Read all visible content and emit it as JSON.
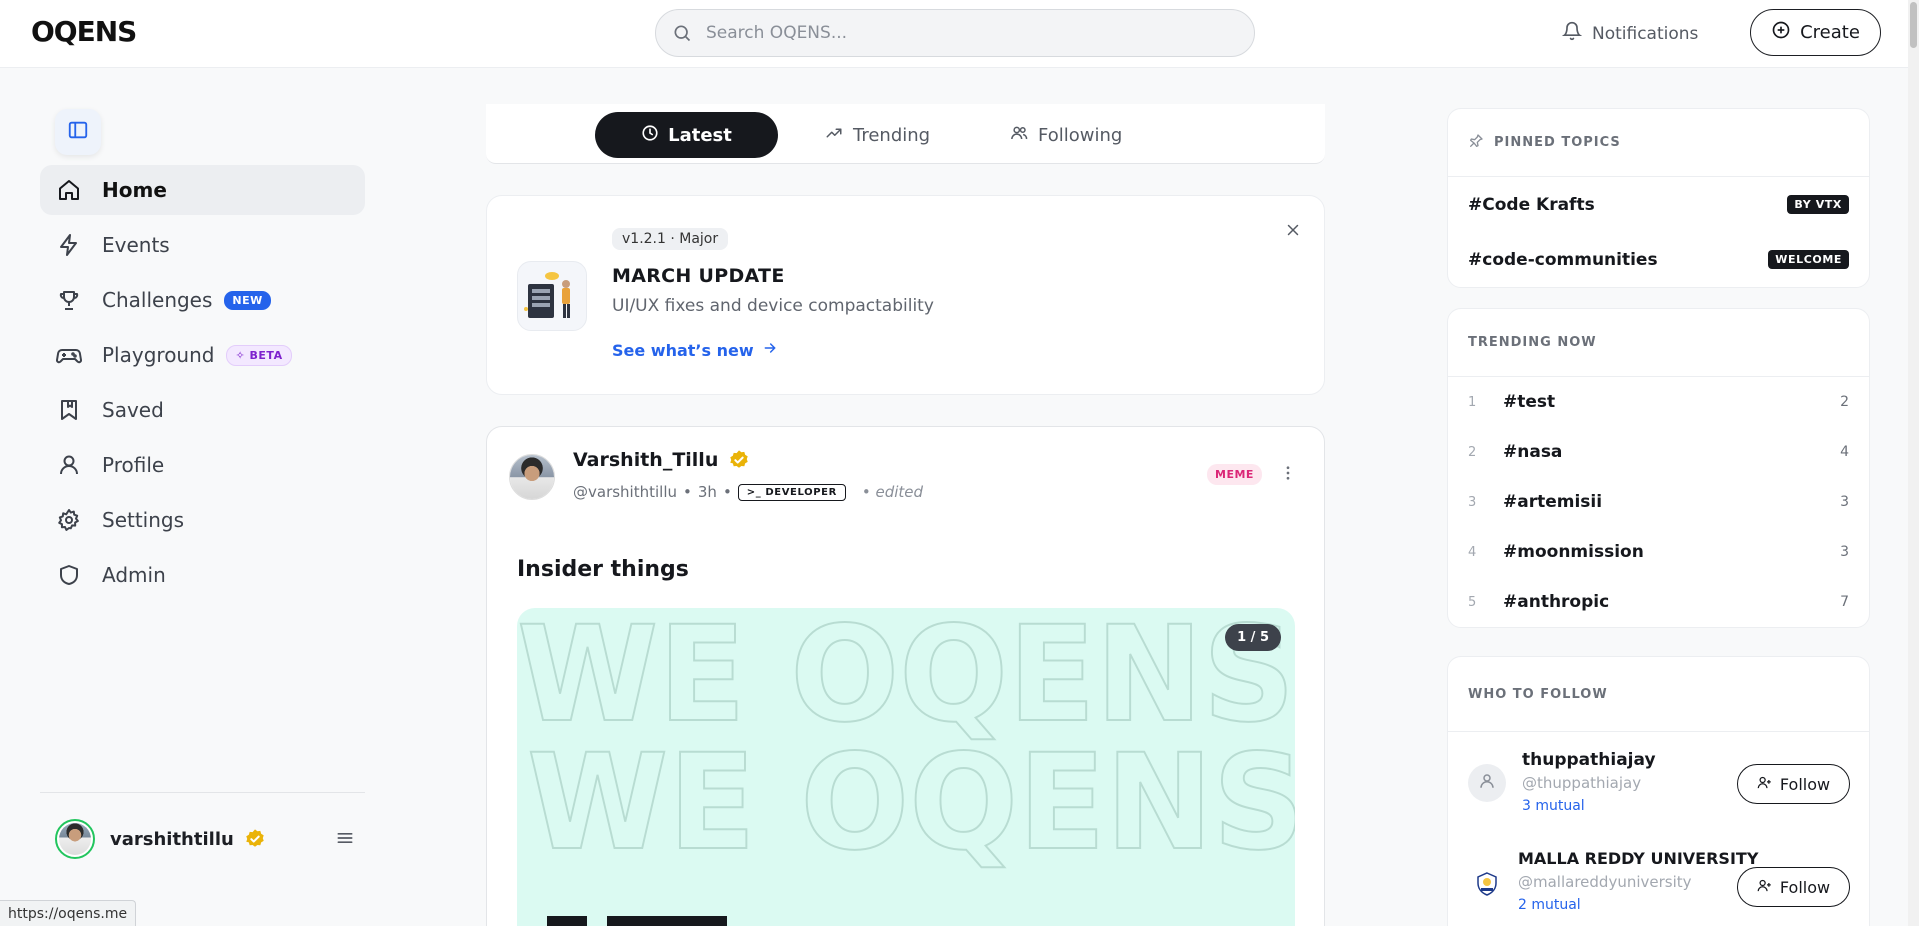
{
  "app": {
    "logo": "OQENS"
  },
  "search": {
    "placeholder": "Search OQENS..."
  },
  "header": {
    "notifications_label": "Notifications",
    "create_label": "Create"
  },
  "sidebar": {
    "items": [
      {
        "label": "Home",
        "icon": "home-icon",
        "active": true
      },
      {
        "label": "Events",
        "icon": "lightning-icon"
      },
      {
        "label": "Challenges",
        "icon": "trophy-icon",
        "badge": "NEW"
      },
      {
        "label": "Playground",
        "icon": "gamepad-icon",
        "badge": "BETA"
      },
      {
        "label": "Saved",
        "icon": "bookmark-icon"
      },
      {
        "label": "Profile",
        "icon": "user-icon"
      },
      {
        "label": "Settings",
        "icon": "gear-icon"
      },
      {
        "label": "Admin",
        "icon": "shield-icon"
      }
    ],
    "user": {
      "username": "varshithtillu"
    }
  },
  "feed_tabs": [
    {
      "label": "Latest",
      "icon": "clock-icon",
      "active": true
    },
    {
      "label": "Trending",
      "icon": "trending-icon"
    },
    {
      "label": "Following",
      "icon": "users-icon"
    }
  ],
  "update_card": {
    "version": "v1.2.1 · Major",
    "title": "MARCH UPDATE",
    "description": "UI/UX fixes and device compactability",
    "link": "See what’s new"
  },
  "post": {
    "author": "Varshith_Tillu",
    "handle": "@varshithtillu",
    "time": "3h",
    "role_badge": "DEVELOPER",
    "edited": "edited",
    "tag": "MEME",
    "title": "Insider things",
    "image_text": "WE OQENS",
    "counter": "1 / 5"
  },
  "pinned_topics": {
    "title": "PINNED TOPICS",
    "items": [
      {
        "name": "#Code Krafts",
        "tag": "BY VTX"
      },
      {
        "name": "#code-communities",
        "tag": "WELCOME"
      }
    ]
  },
  "trending": {
    "title": "TRENDING NOW",
    "items": [
      {
        "rank": "1",
        "name": "#test",
        "count": "2"
      },
      {
        "rank": "2",
        "name": "#nasa",
        "count": "4"
      },
      {
        "rank": "3",
        "name": "#artemisii",
        "count": "3"
      },
      {
        "rank": "4",
        "name": "#moonmission",
        "count": "3"
      },
      {
        "rank": "5",
        "name": "#anthropic",
        "count": "7"
      }
    ]
  },
  "who_to_follow": {
    "title": "WHO TO FOLLOW",
    "items": [
      {
        "name": "thuppathiajay",
        "handle": "@thuppathiajay",
        "mutual": "3 mutual",
        "button": "Follow"
      },
      {
        "name": "MALLA REDDY UNIVERSITY",
        "handle": "@mallareddyuniversity",
        "mutual": "2 mutual",
        "button": "Follow"
      }
    ]
  },
  "status_bar": {
    "url": "https://oqens.me"
  },
  "colors": {
    "accent": "#2563eb",
    "dark": "#16181d",
    "verified": "#eab308",
    "meme": "#db2777",
    "beta": "#7e22ce"
  }
}
